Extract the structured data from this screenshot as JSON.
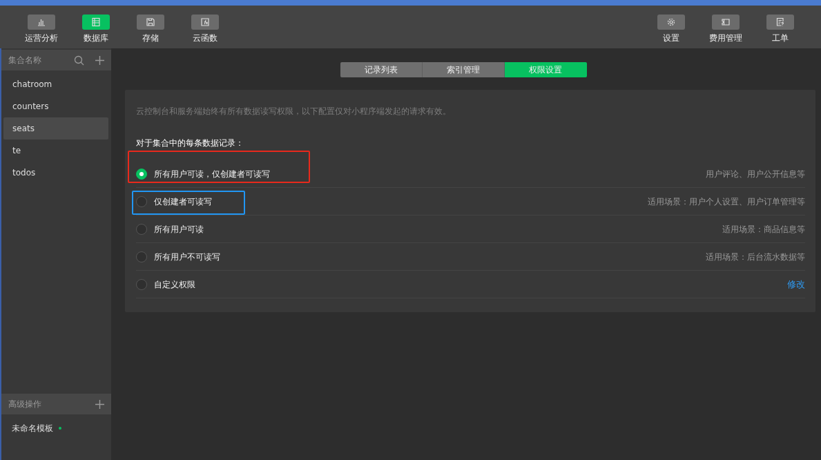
{
  "toolbar": {
    "left": [
      {
        "label": "运营分析",
        "selected": false
      },
      {
        "label": "数据库",
        "selected": true
      },
      {
        "label": "存储",
        "selected": false
      },
      {
        "label": "云函数",
        "selected": false
      }
    ],
    "right": [
      {
        "label": "设置",
        "selected": false
      },
      {
        "label": "费用管理",
        "selected": false
      },
      {
        "label": "工单",
        "selected": false
      }
    ]
  },
  "sidebar": {
    "collections_header": "集合名称",
    "items": [
      {
        "label": "chatroom",
        "selected": false
      },
      {
        "label": "counters",
        "selected": false
      },
      {
        "label": "seats",
        "selected": true
      },
      {
        "label": "te",
        "selected": false
      },
      {
        "label": "todos",
        "selected": false
      }
    ],
    "advanced_header": "高级操作",
    "templates": [
      {
        "label": "未命名模板",
        "color": "#07c160"
      }
    ]
  },
  "tabs": [
    {
      "label": "记录列表",
      "selected": false
    },
    {
      "label": "索引管理",
      "selected": false
    },
    {
      "label": "权限设置",
      "selected": true
    }
  ],
  "notice": "云控制台和服务端始终有所有数据读写权限，以下配置仅对小程序端发起的请求有效。",
  "heading": "对于集合中的每条数据记录：",
  "options": [
    {
      "label": "所有用户可读，仅创建者可读写",
      "hint": "用户评论、用户公开信息等",
      "kind": "hint",
      "selected": true,
      "color": "#e8291c"
    },
    {
      "label": "仅创建者可读写",
      "hint": "适用场景：用户个人设置、用户订单管理等",
      "kind": "hint",
      "selected": false,
      "color": "#2196f3"
    },
    {
      "label": "所有用户可读",
      "hint": "适用场景：商品信息等",
      "kind": "hint",
      "selected": false
    },
    {
      "label": "所有用户不可读写",
      "hint": "适用场景：后台流水数据等",
      "kind": "hint",
      "selected": false
    },
    {
      "label": "自定义权限",
      "hint": "修改",
      "kind": "link",
      "selected": false
    }
  ]
}
